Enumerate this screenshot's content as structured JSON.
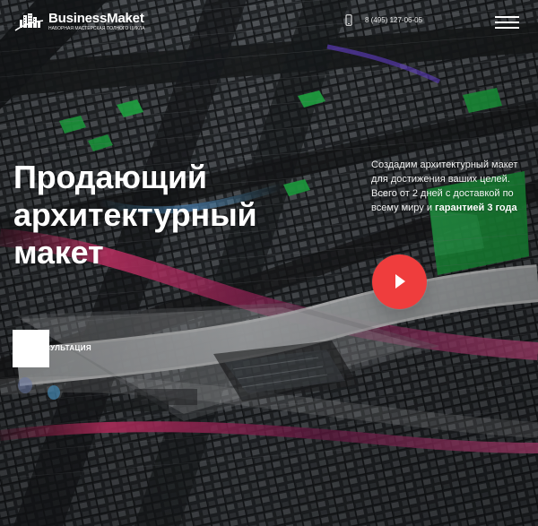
{
  "brand": {
    "name": "BusinessMaket",
    "tagline": "НАБОРНАЯ МАСТЕРСКАЯ ПОЛНОГО ЦИКЛА"
  },
  "header": {
    "phone_icon": "mobile-phone-icon",
    "phone": "8 (495) 127-06-05",
    "menu_icon": "hamburger-menu-icon"
  },
  "hero": {
    "headline": "Продающий архитектурный макет",
    "description_before_bold": "Создадим архитектурный макет для достижения ваших целей. Всего от 2 дней с доставкой по всему миру и ",
    "description_bold": "гарантией 3 года",
    "play_icon": "play-icon",
    "play_color": "#ef3d3d",
    "consult_label": "КОНСУЛЬТАЦИЯ"
  }
}
